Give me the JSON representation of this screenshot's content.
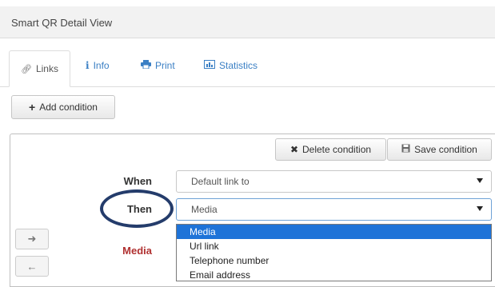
{
  "panel": {
    "title": "Smart QR Detail View"
  },
  "tabs": [
    {
      "label": "Links",
      "icon": "link-icon"
    },
    {
      "label": "Info",
      "icon": "info-icon"
    },
    {
      "label": "Print",
      "icon": "print-icon"
    },
    {
      "label": "Statistics",
      "icon": "chart-icon"
    }
  ],
  "toolbar": {
    "add_condition_label": "Add condition"
  },
  "condition": {
    "delete_label": "Delete condition",
    "save_label": "Save condition",
    "when_label": "When",
    "when_value": "Default link to",
    "then_label": "Then",
    "then_value": "Media",
    "media_label": "Media",
    "options": [
      "Media",
      "Url link",
      "Telephone number",
      "Email address"
    ],
    "selected_option": "Media"
  },
  "colors": {
    "accent": "#3a7fc4",
    "selection": "#1e73d8",
    "oval": "#243c6b",
    "media_label": "#b03030"
  }
}
